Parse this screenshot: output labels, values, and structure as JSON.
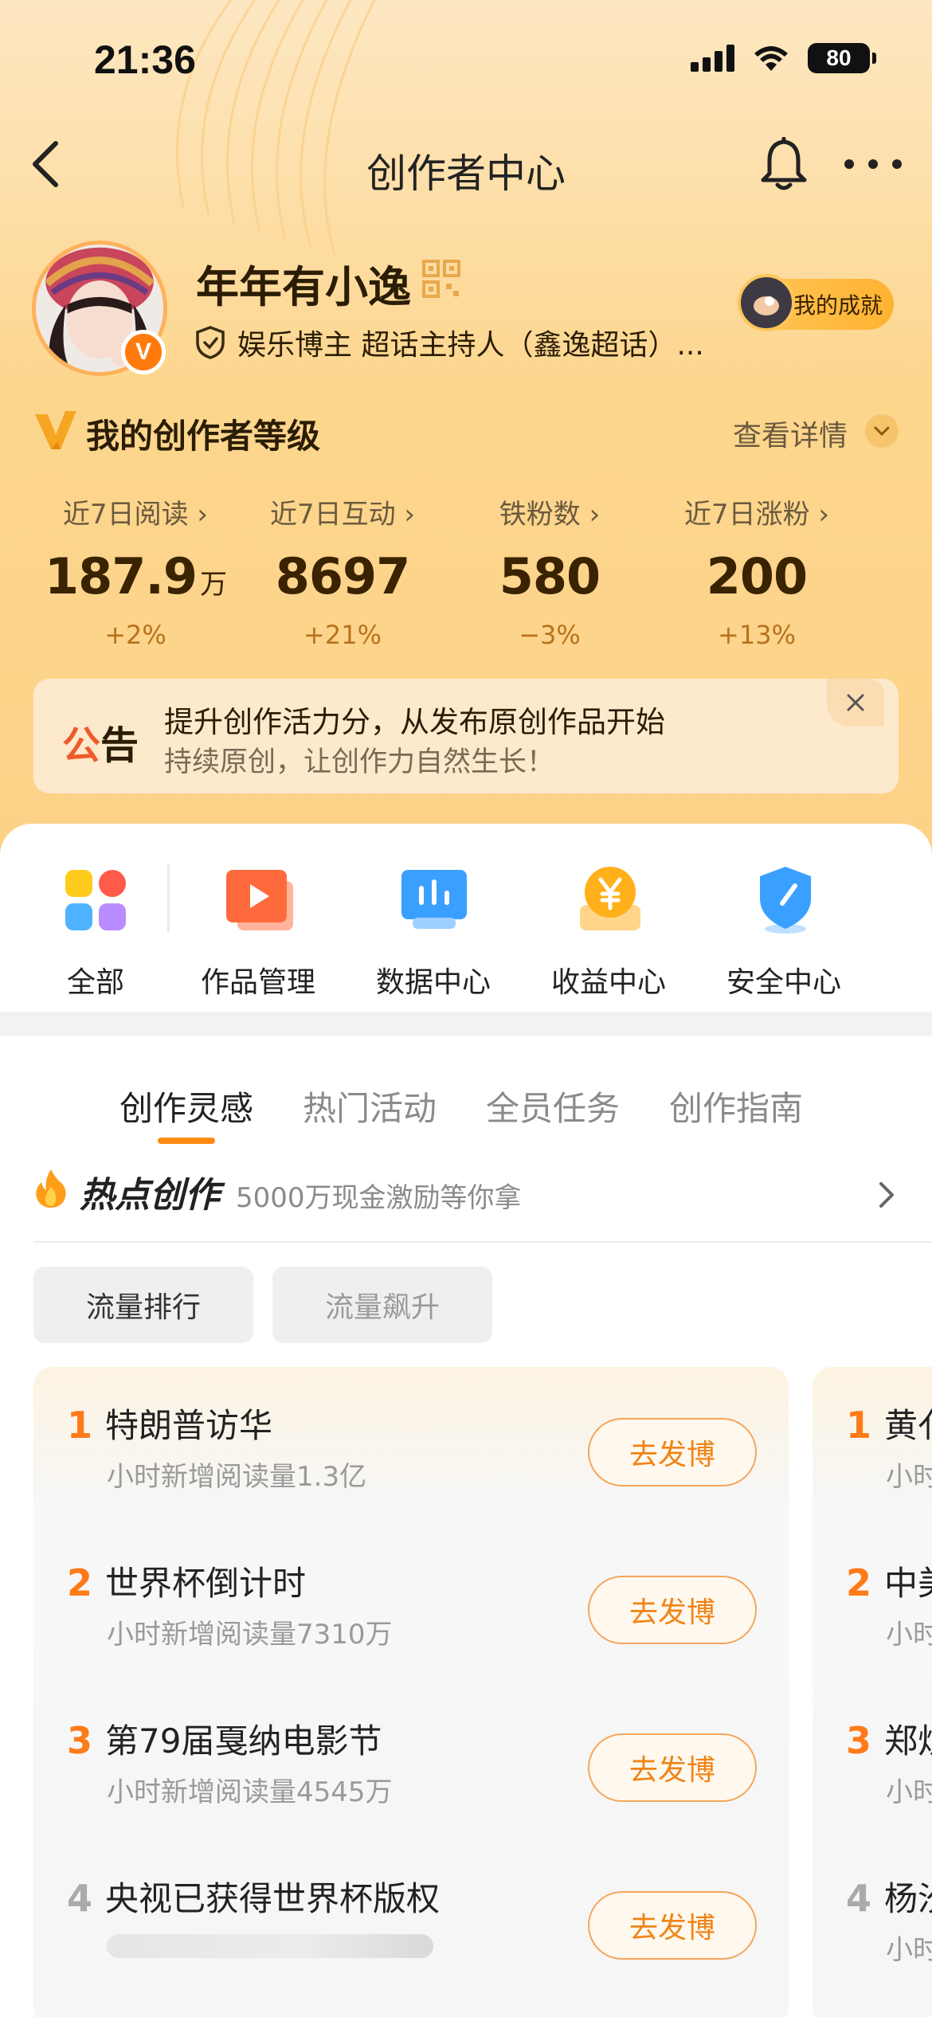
{
  "status": {
    "time": "21:36",
    "battery": "80"
  },
  "nav": {
    "title": "创作者中心"
  },
  "profile": {
    "name": "年年有小逸",
    "verify_text": "娱乐博主 超话主持人（鑫逸超话）...",
    "badge": "V",
    "achievement": "我的成就"
  },
  "level": {
    "title": "我的创作者等级",
    "detail": "查看详情"
  },
  "stats": [
    {
      "label": "近7日阅读 ›",
      "value": "187.9",
      "unit": "万",
      "change": "+2%"
    },
    {
      "label": "近7日互动 ›",
      "value": "8697",
      "unit": "",
      "change": "+21%"
    },
    {
      "label": "铁粉数 ›",
      "value": "580",
      "unit": "",
      "change": "−3%"
    },
    {
      "label": "近7日涨粉 ›",
      "value": "200",
      "unit": "",
      "change": "+13%"
    }
  ],
  "notice": {
    "tag_1": "公",
    "tag_2": "告",
    "line1": "提升创作活力分，从发布原创作品开始",
    "line2": "持续原创，让创作力自然生长！"
  },
  "tools": [
    {
      "label": "全部",
      "icon": "grid-icon"
    },
    {
      "label": "作品管理",
      "icon": "video-play-icon"
    },
    {
      "label": "数据中心",
      "icon": "chart-icon"
    },
    {
      "label": "收益中心",
      "icon": "yen-coin-icon"
    },
    {
      "label": "安全中心",
      "icon": "shield-icon"
    }
  ],
  "tabs": [
    "创作灵感",
    "热门活动",
    "全员任务",
    "创作指南"
  ],
  "hot": {
    "title": "热点创作",
    "subtitle": "5000万现金激励等你拿"
  },
  "chips": [
    "流量排行",
    "流量飙升"
  ],
  "list": [
    {
      "rank": "1",
      "title": "特朗普访华",
      "sub": "小时新增阅读量1.3亿",
      "button": "去发博"
    },
    {
      "rank": "2",
      "title": "世界杯倒计时",
      "sub": "小时新增阅读量7310万",
      "button": "去发博"
    },
    {
      "rank": "3",
      "title": "第79届戛纳电影节",
      "sub": "小时新增阅读量4545万",
      "button": "去发博"
    },
    {
      "rank": "4",
      "title": "央视已获得世界杯版权",
      "sub": "",
      "button": "去发博"
    }
  ],
  "list2": [
    {
      "rank": "1",
      "title": "黄亻",
      "sub": "小时"
    },
    {
      "rank": "2",
      "title": "中美",
      "sub": "小时"
    },
    {
      "rank": "3",
      "title": "郑炽",
      "sub": "小时"
    },
    {
      "rank": "4",
      "title": "杨汐",
      "sub": "小时"
    }
  ],
  "colors": {
    "accent": "#ff7a18",
    "header_bg": "#fdd68e",
    "notice_red": "#ef5a2a"
  }
}
